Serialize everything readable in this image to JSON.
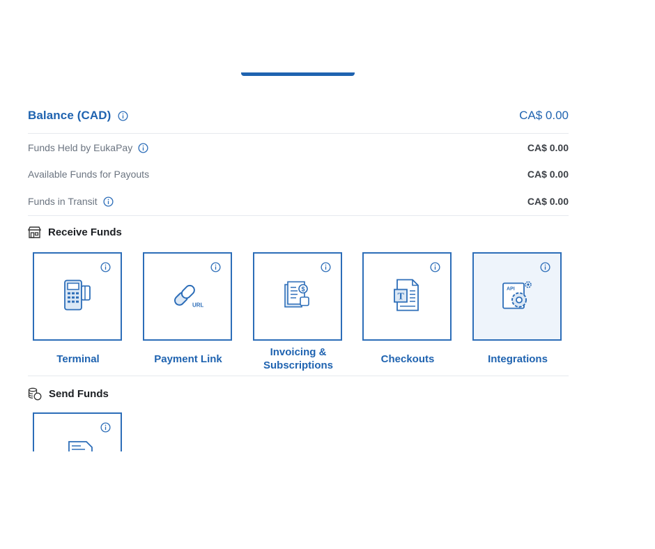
{
  "balance": {
    "title": "Balance (CAD)",
    "amount": "CA$ 0.00"
  },
  "funds": [
    {
      "label": "Funds Held by EukaPay",
      "value": "CA$ 0.00",
      "has_info": true
    },
    {
      "label": "Available Funds for Payouts",
      "value": "CA$ 0.00",
      "has_info": false
    },
    {
      "label": "Funds in Transit",
      "value": "CA$ 0.00",
      "has_info": true
    }
  ],
  "receive": {
    "title": "Receive Funds",
    "icon": "storefront-icon",
    "tiles": [
      {
        "label": "Terminal",
        "icon": "terminal-icon"
      },
      {
        "label": "Payment Link",
        "icon": "link-url-icon"
      },
      {
        "label_line1": "Invoicing &",
        "label_line2": "Subscriptions",
        "icon": "invoice-icon"
      },
      {
        "label": "Checkouts",
        "icon": "checkout-document-icon"
      },
      {
        "label": "Integrations",
        "icon": "api-gear-icon",
        "active": true
      }
    ]
  },
  "send": {
    "title": "Send Funds",
    "icon": "coins-icon"
  },
  "colors": {
    "accent": "#1f63b0",
    "tile_border": "#2c6db8",
    "active_tile_bg": "#eef4fb",
    "muted_text": "#6b7480"
  }
}
